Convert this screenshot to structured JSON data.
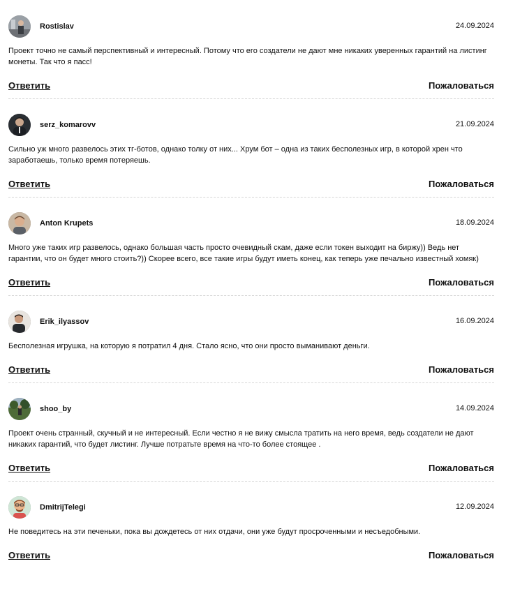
{
  "comments": [
    {
      "username": "Rostislav",
      "date": "24.09.2024",
      "text": "Проект точно не самый перспективный и интересный. Потому что его создатели не дают мне никаких уверенных гарантий на листинг монеты. Так что я пасс!",
      "reply_label": "Ответить",
      "report_label": "Пожаловаться"
    },
    {
      "username": "serz_komarovv",
      "date": "21.09.2024",
      "text": "Сильно уж много развелось этих тг-ботов, однако толку от них... Хрум бот – одна из таких бесполезных игр, в которой хрен что заработаешь, только время потеряешь.",
      "reply_label": "Ответить",
      "report_label": "Пожаловаться"
    },
    {
      "username": "Anton Krupets",
      "date": "18.09.2024",
      "text": "Много уже таких игр развелось, однако большая часть просто очевидный скам, даже если токен выходит на биржу)) Ведь нет гарантии, что он будет много стоить?)) Скорее всего, все такие игры будут иметь конец, как теперь уже печально известный хомяк)",
      "reply_label": "Ответить",
      "report_label": "Пожаловаться"
    },
    {
      "username": "Erik_ilyassov",
      "date": "16.09.2024",
      "text": "Бесполезная игрушка, на которую я потратил 4 дня. Стало ясно, что они просто выманивают деньги.",
      "reply_label": "Ответить",
      "report_label": "Пожаловаться"
    },
    {
      "username": "shoo_by",
      "date": "14.09.2024",
      "text": "Проект очень странный, скучный и не интересный. Если честно я не вижу смысла тратить на него время, ведь создатели не дают никаких гарантий, что будет листинг. Лучше потратьте время на что-то более стоящее .",
      "reply_label": "Ответить",
      "report_label": "Пожаловаться"
    },
    {
      "username": "DmitrijTelegi",
      "date": "12.09.2024",
      "text": "Не поведитесь на эти печеньки, пока вы дождетесь от них отдачи, они уже будут просроченными и несъедобными.",
      "reply_label": "Ответить",
      "report_label": "Пожаловаться"
    }
  ],
  "avatars": [
    {
      "icon": "user-photo-avatar",
      "bg": "#8a8f94"
    },
    {
      "icon": "user-photo-avatar",
      "bg": "#2e3338"
    },
    {
      "icon": "user-photo-avatar",
      "bg": "#b8a48f"
    },
    {
      "icon": "user-photo-avatar",
      "bg": "#4a4440"
    },
    {
      "icon": "user-photo-avatar",
      "bg": "#4f6a3c"
    },
    {
      "icon": "cartoon-avatar",
      "bg": "#cfe6d6"
    }
  ]
}
